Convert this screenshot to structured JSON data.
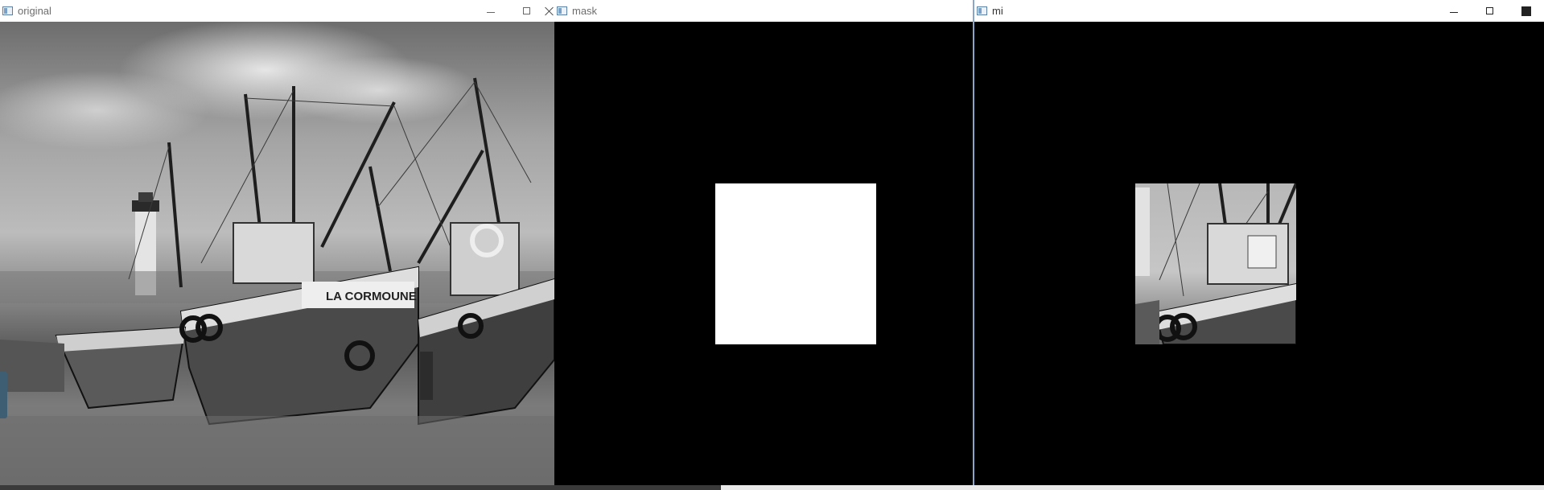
{
  "windows": [
    {
      "title": "original",
      "state": "inactive",
      "content": "harbor-boats-photo"
    },
    {
      "title": "mask",
      "state": "inactive",
      "content": "black-canvas-with-white-rectangle",
      "colors": {
        "background": "#000000",
        "mask_fill": "#ffffff"
      }
    },
    {
      "title": "mi",
      "state": "active",
      "content": "black-canvas-with-masked-photo-region"
    }
  ],
  "boat_name_text": "LA CORMOUNE",
  "icons": {
    "app": "window-app-icon",
    "minimize": "minimize-icon",
    "maximize": "maximize-icon",
    "close": "close-icon"
  }
}
